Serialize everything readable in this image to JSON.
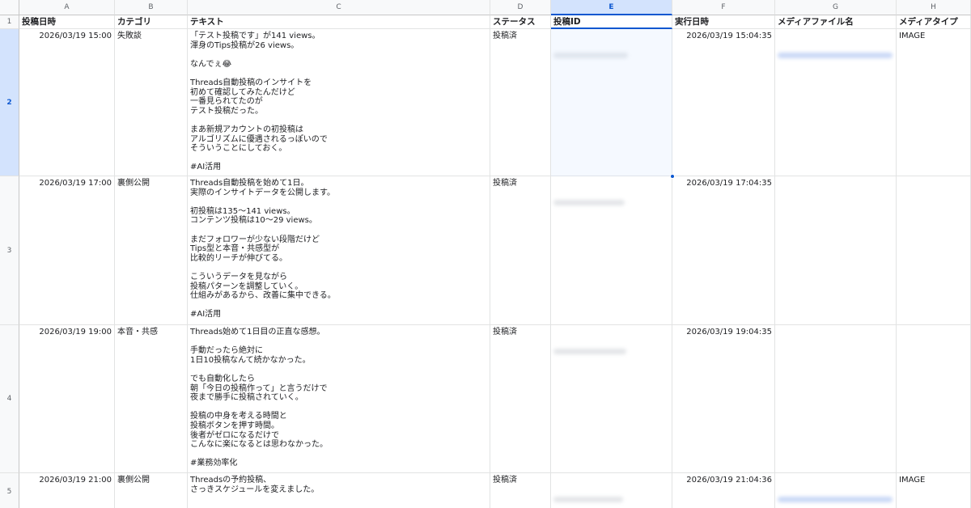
{
  "colors": {
    "accent": "#0b57d0",
    "selection": "#d3e3fd",
    "grid": "#e2e3e3"
  },
  "columns": [
    "A",
    "B",
    "C",
    "D",
    "E",
    "F",
    "G",
    "H"
  ],
  "headers": [
    "投稿日時",
    "カテゴリ",
    "テキスト",
    "ステータス",
    "投稿ID",
    "実行日時",
    "メディアファイル名",
    "メディアタイプ"
  ],
  "rows": [
    {
      "num": "2",
      "date": "2026/03/19 15:00",
      "category": "失敗談",
      "text": "「テスト投稿です」が141 views。\n渾身のTips投稿が26 views。\n\nなんでぇ😂\n\nThreads自動投稿のインサイトを\n初めて確認してみたんだけど\n一番見られてたのが\nテスト投稿だった。\n\nまあ新規アカウントの初投稿は\nアルゴリズムに優遇されるっぽいので\nそういうことにしておく。\n\n#AI活用",
      "status": "投稿済",
      "exec": "2026/03/19 15:04:35",
      "media_type": "IMAGE"
    },
    {
      "num": "3",
      "date": "2026/03/19 17:00",
      "category": "裏側公開",
      "text": "Threads自動投稿を始めて1日。\n実際のインサイトデータを公開します。\n\n初投稿は135〜141 views。\nコンテンツ投稿は10〜29 views。\n\nまだフォロワーが少ない段階だけど\nTips型と本音・共感型が\n比較的リーチが伸びてる。\n\nこういうデータを見ながら\n投稿パターンを調整していく。\n仕組みがあるから、改善に集中できる。\n\n#AI活用",
      "status": "投稿済",
      "exec": "2026/03/19 17:04:35",
      "media_type": ""
    },
    {
      "num": "4",
      "date": "2026/03/19 19:00",
      "category": "本音・共感",
      "text": "Threads始めて1日目の正直な感想。\n\n手動だったら絶対に\n1日10投稿なんて続かなかった。\n\nでも自動化したら\n朝「今日の投稿作って」と言うだけで\n夜まで勝手に投稿されていく。\n\n投稿の中身を考える時間と\n投稿ボタンを押す時間。\n後者がゼロになるだけで\nこんなに楽になるとは思わなかった。\n\n#業務効率化",
      "status": "投稿済",
      "exec": "2026/03/19 19:04:35",
      "media_type": ""
    },
    {
      "num": "5",
      "date": "2026/03/19 21:00",
      "category": "裏側公開",
      "text": "Threadsの予約投稿、\nさっきスケジュールを変えました。",
      "status": "投稿済",
      "exec": "2026/03/19 21:04:36",
      "media_type": "IMAGE"
    }
  ]
}
